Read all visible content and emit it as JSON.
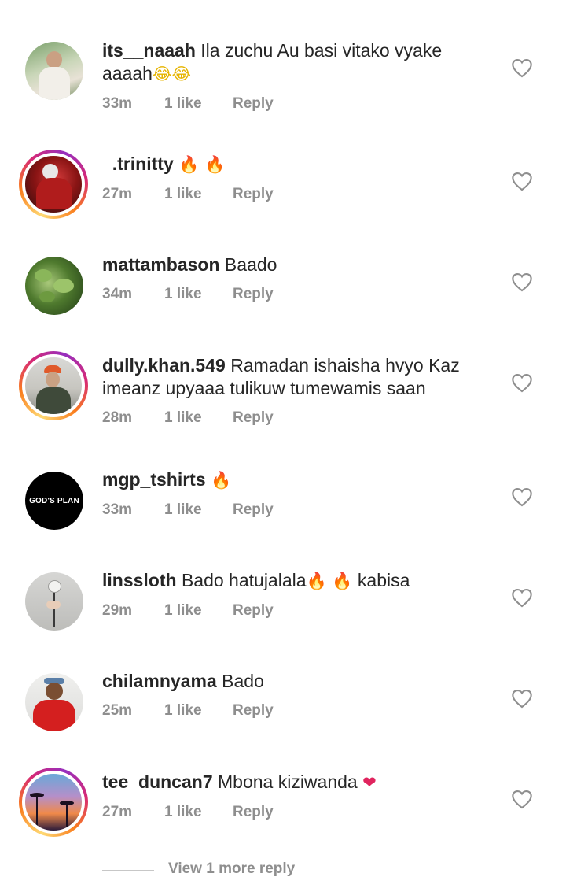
{
  "comments": [
    {
      "username": "its__naaah",
      "text": " Ila zuchu Au basi vitako vyake",
      "text_line2": "aaaah",
      "emoji": "😂😂",
      "time": "33m",
      "likes": "1 like",
      "reply": "Reply",
      "avatar": "person-portrait",
      "story_ring": false
    },
    {
      "username": "_.trinitty",
      "text": "",
      "emoji": "🔥 🔥",
      "time": "27m",
      "likes": "1 like",
      "reply": "Reply",
      "avatar": "red-photo",
      "story_ring": true
    },
    {
      "username": "mattambason",
      "text": " Baado",
      "time": "34m",
      "likes": "1 like",
      "reply": "Reply",
      "avatar": "green-plants",
      "story_ring": false
    },
    {
      "username": "dully.khan.549",
      "text": " Ramadan ishaisha hvyo Kaz",
      "text_line2": "imeanz upyaaa tulikuw tumewamis saan",
      "time": "28m",
      "likes": "1 like",
      "reply": "Reply",
      "avatar": "person-cap",
      "story_ring": true
    },
    {
      "username": "mgp_tshirts",
      "text": "",
      "emoji": "🔥",
      "time": "33m",
      "likes": "1 like",
      "reply": "Reply",
      "avatar": "gods-plan-logo",
      "avatar_text": "GOD'S PLAN",
      "story_ring": false
    },
    {
      "username": "linssloth",
      "text": " Bado hatujalala",
      "emoji": "🔥 🔥",
      "text_after": " kabisa",
      "time": "29m",
      "likes": "1 like",
      "reply": "Reply",
      "avatar": "hand-flower",
      "story_ring": false
    },
    {
      "username": "chilamnyama",
      "text": " Bado",
      "time": "25m",
      "likes": "1 like",
      "reply": "Reply",
      "avatar": "person-red-jacket",
      "story_ring": false
    },
    {
      "username": "tee_duncan7",
      "text": " Mbona kiziwanda",
      "emoji": "❤",
      "time": "27m",
      "likes": "1 like",
      "reply": "Reply",
      "avatar": "sunset-palms",
      "story_ring": true
    }
  ],
  "view_more": "View 1 more reply",
  "colors": {
    "text": "#262626",
    "meta": "#8e8e8e",
    "fire": "#f5761a",
    "heart": "#e0245e"
  },
  "icons": {
    "like": "heart-outline-icon"
  }
}
